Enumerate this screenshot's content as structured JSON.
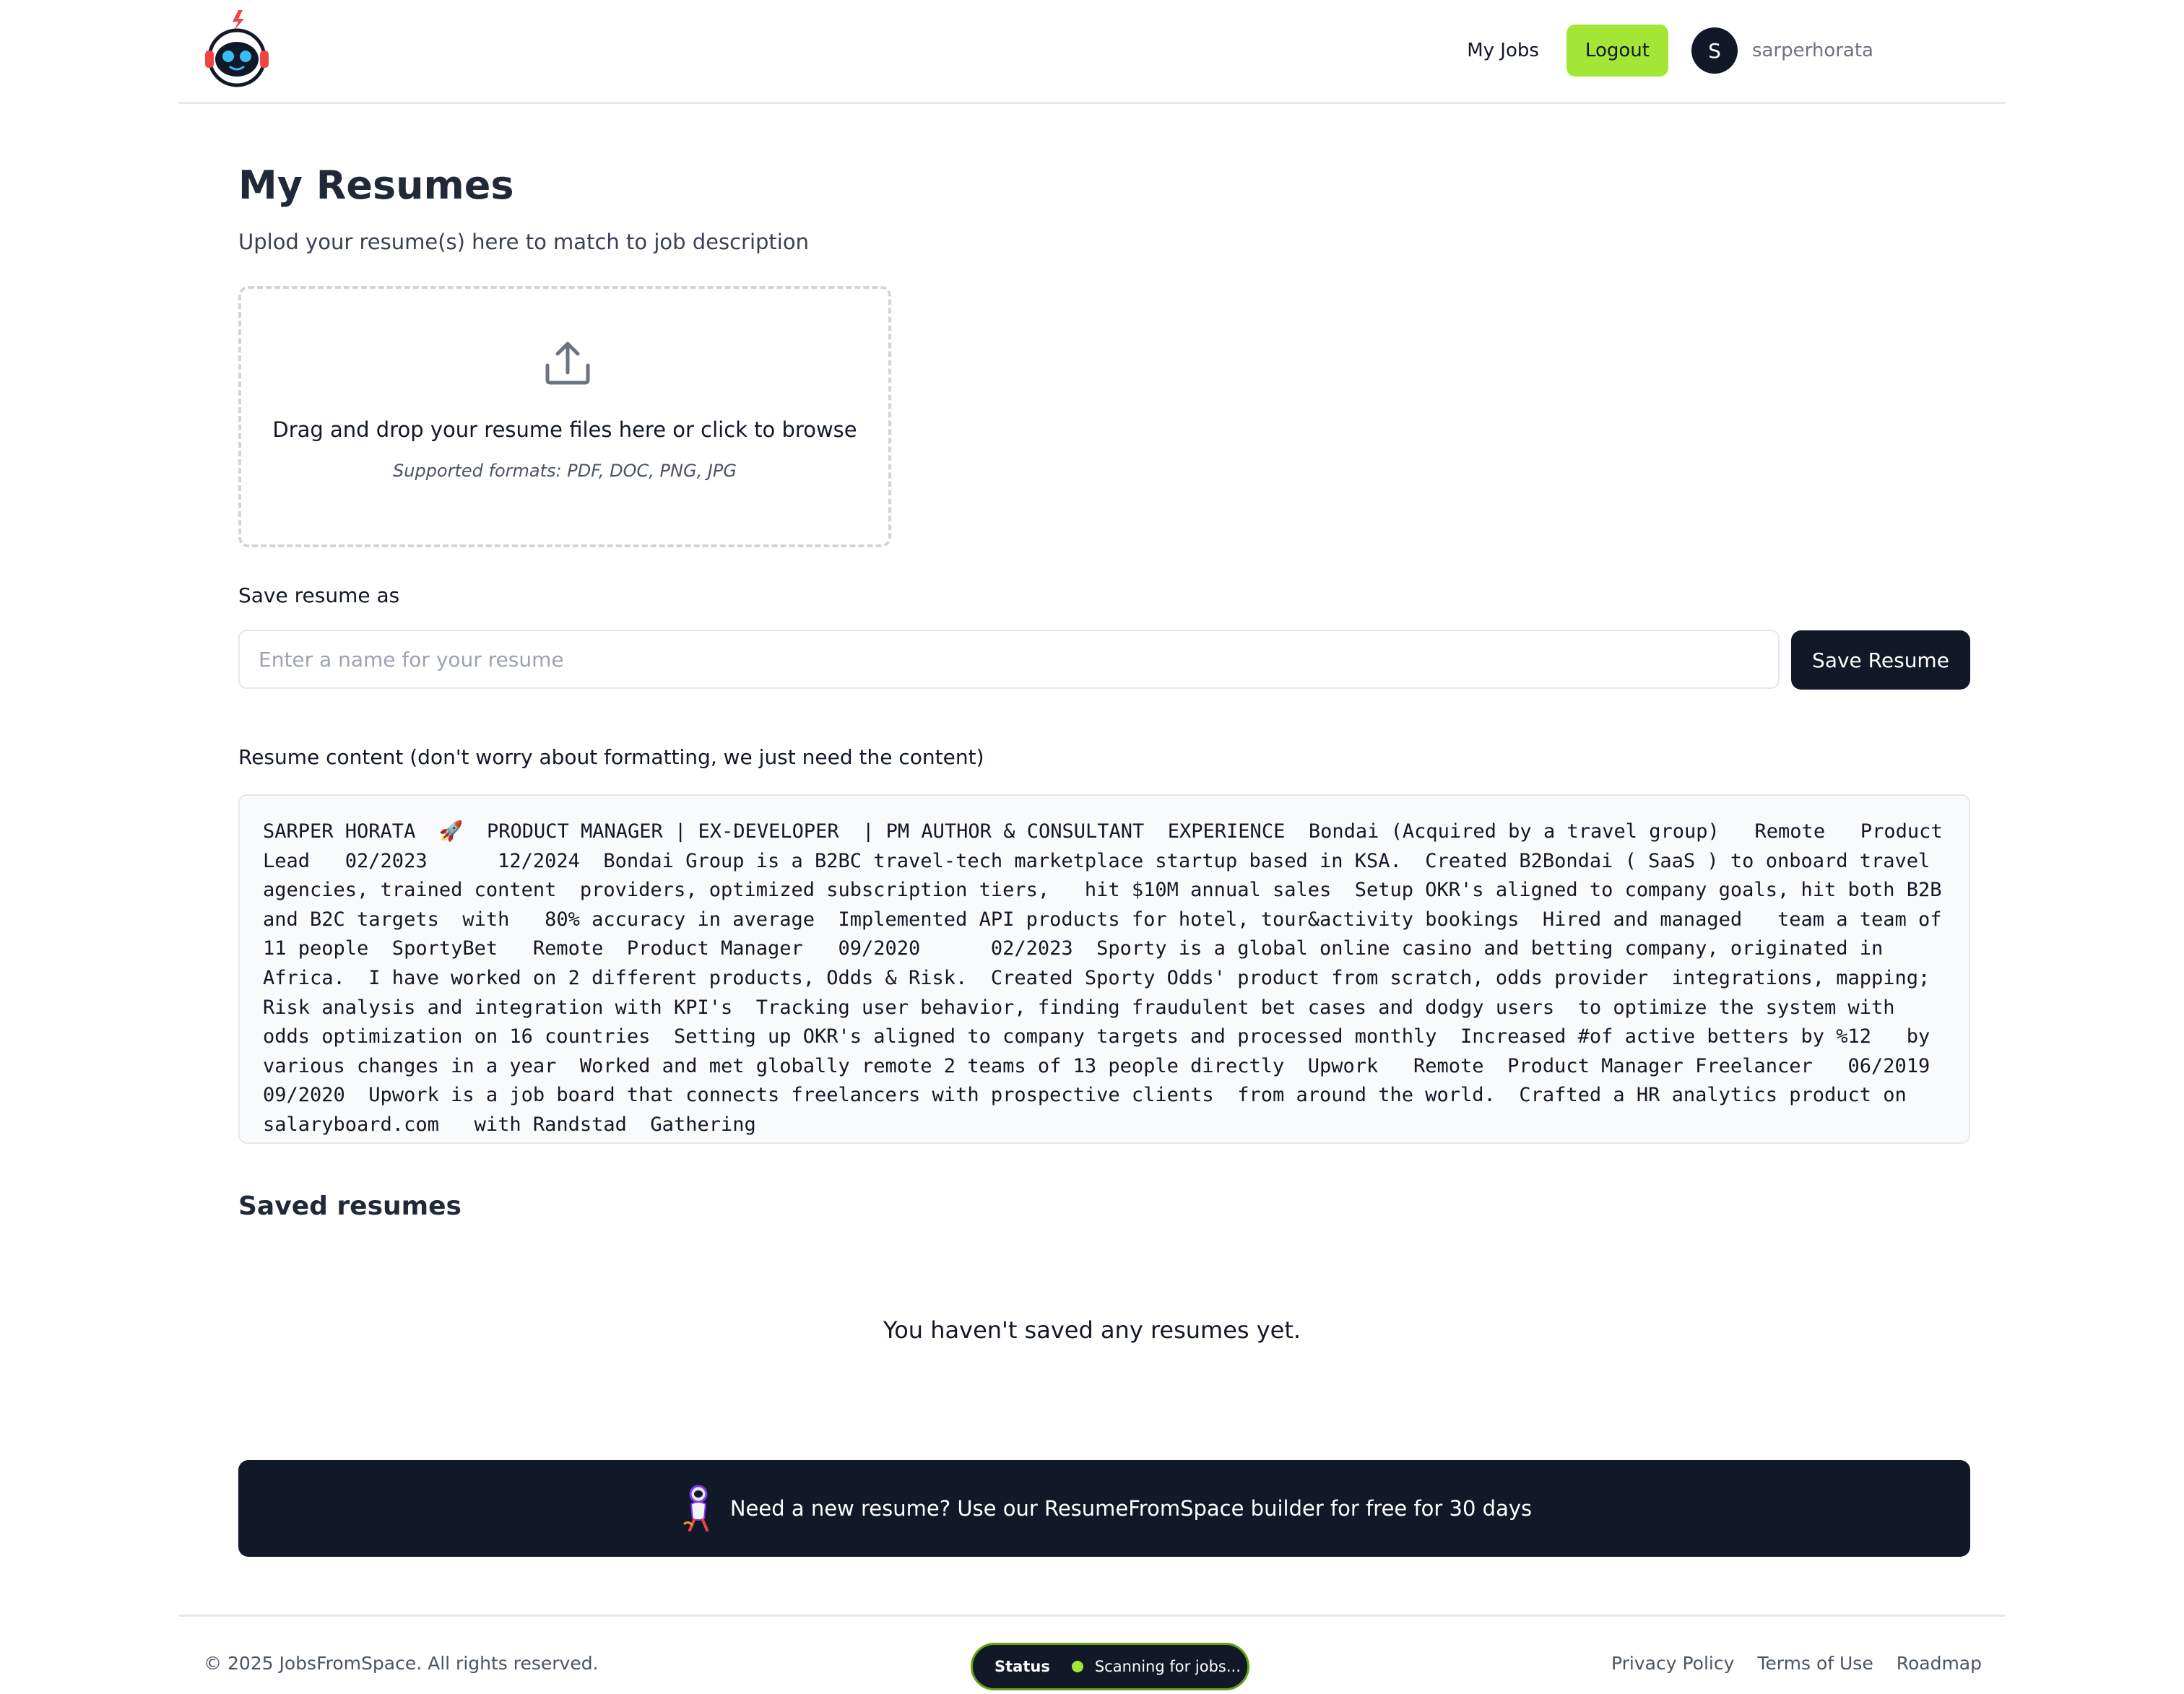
{
  "header": {
    "logo_icon": "robot-mascot-icon",
    "nav_my_jobs": "My Jobs",
    "logout_label": "Logout",
    "avatar_initial": "S",
    "username": "sarperhorata",
    "accent_color": "#a3e635",
    "dark_color": "#111827"
  },
  "main": {
    "title": "My Resumes",
    "subtitle": "Uplod your resume(s) here to match to job description",
    "dropzone": {
      "icon": "upload-icon",
      "text": "Drag and drop your resume files here or click to browse",
      "formats": "Supported formats: PDF, DOC, PNG, JPG"
    },
    "save_as_label": "Save resume as",
    "name_placeholder": "Enter a name for your resume",
    "name_value": "",
    "save_button": "Save Resume",
    "content_label": "Resume content (don't worry about formatting, we just need the content)",
    "content_text": "SARPER HORATA  🚀  PRODUCT MANAGER | EX-DEVELOPER  | PM AUTHOR & CONSULTANT  EXPERIENCE  Bondai (Acquired by a travel group)   Remote   Product Lead   02/2023      12/2024  Bondai Group is a B2BC travel-tech marketplace startup based in KSA.  Created B2Bondai ( SaaS ) to onboard travel agencies, trained content  providers, optimized subscription tiers,   hit $10M annual sales  Setup OKR's aligned to company goals, hit both B2B and B2C targets  with   80% accuracy in average  Implemented API products for hotel, tour&activity bookings  Hired and managed   team a team of   11 people  SportyBet   Remote  Product Manager   09/2020      02/2023  Sporty is a global online casino and betting company, originated in Africa.  I have worked on 2 different products, Odds & Risk.  Created Sporty Odds' product from scratch, odds provider  integrations, mapping; Risk analysis and integration with KPI's  Tracking user behavior, finding fraudulent bet cases and dodgy users  to optimize the system with   odds optimization on 16 countries  Setting up OKR's aligned to company targets and processed monthly  Increased #of active betters by %12   by various changes in a year  Worked and met globally remote 2 teams of 13 people directly  Upwork   Remote  Product Manager Freelancer   06/2019      09/2020  Upwork is a job board that connects freelancers with prospective clients  from around the world.  Crafted a HR analytics product on   salaryboard.com   with Randstad  Gathering",
    "saved_title": "Saved resumes",
    "empty_message": "You haven't saved any resumes yet."
  },
  "banner": {
    "icon": "astronaut-rocket-icon",
    "text": "Need a new resume? Use our ResumeFromSpace builder for free for 30 days"
  },
  "footer": {
    "copyright": "© 2025 JobsFromSpace. All rights reserved.",
    "status_label": "Status",
    "status_text": "Scanning for jobs...",
    "links": [
      "Privacy Policy",
      "Terms of Use",
      "Roadmap"
    ]
  }
}
